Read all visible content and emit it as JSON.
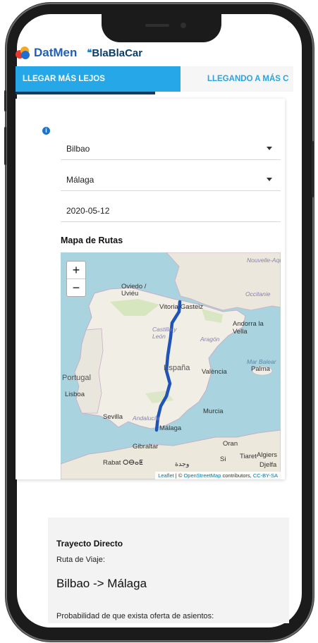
{
  "brand": {
    "datmen": "DatMen",
    "blablacar": "BlaBlaCar"
  },
  "tabs": [
    {
      "label": "LLEGAR MÁS LEJOS",
      "active": true
    },
    {
      "label": "LLEGANDO A MÁS C",
      "active": false
    }
  ],
  "form": {
    "origin": "Bilbao",
    "destination": "Málaga",
    "date": "2020-05-12"
  },
  "map": {
    "title": "Mapa de Rutas",
    "zoom_in": "+",
    "zoom_out": "−",
    "labels": {
      "nouvelle_aquitaine": "Nouvelle-Aquitaine",
      "occitanie": "Occitanie",
      "oviedo": "Oviedo / Uviéu",
      "vitoria": "Vitoria-Gasteiz",
      "andorra": "Andorra la Vella",
      "castilla": "Castilla y León",
      "aragon": "Aragón",
      "espana": "España",
      "mar_balear": "Mar Balear",
      "valencia": "València",
      "palma": "Palma",
      "portugal": "Portugal",
      "lisboa": "Lisboa",
      "murcia": "Murcia",
      "sevilla": "Sevilla",
      "andalucia": "Andalucía",
      "malaga": "Málaga",
      "algiers": "Algiers",
      "oran": "Oran",
      "gibraltar": "Gibraltar",
      "rabat": "Rabat ⵔⴱⴰⵟ",
      "tiaret": "Tiaret",
      "djelfa": "Djelfa",
      "sidi": "Si",
      "oujda": "وجدة"
    },
    "attribution": {
      "leaflet": "Leaflet",
      "sep": " | © ",
      "osm": "OpenStreetMap",
      "mid": " contributors, ",
      "license": "CC-BY-SA"
    },
    "route_color": "#2053b8"
  },
  "result": {
    "title": "Trayecto Directo",
    "subtitle": "Ruta de Viaje:",
    "route": "Bilbao -> Málaga",
    "probability_label": "Probabilidad de que exista oferta de asientos:"
  },
  "colors": {
    "tab_active": "#25a7e8",
    "tab_underline": "#0e3e63",
    "brand_blue": "#1f5fb8"
  }
}
